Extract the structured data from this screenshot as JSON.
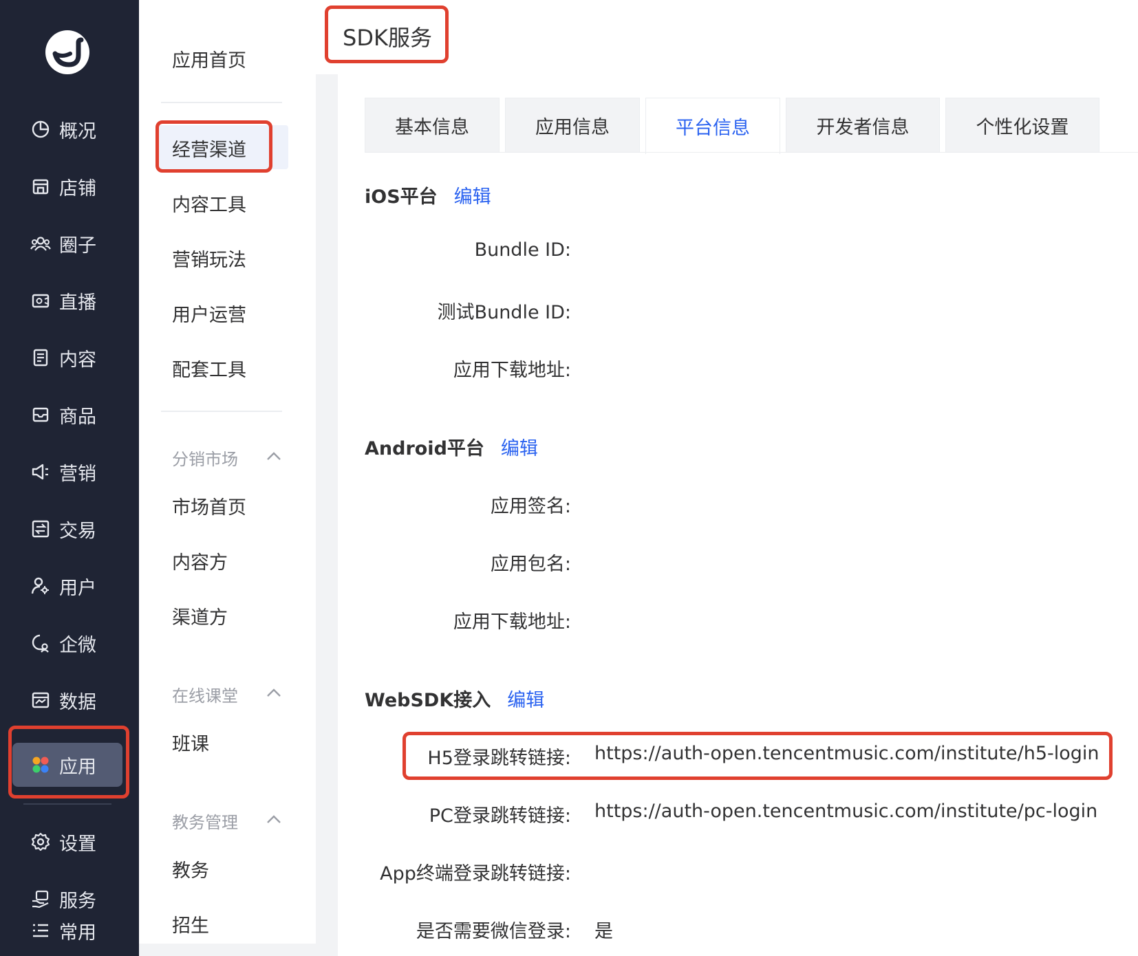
{
  "rail": {
    "items": [
      {
        "label": "概况",
        "icon": "pie-chart-icon"
      },
      {
        "label": "店铺",
        "icon": "store-icon"
      },
      {
        "label": "圈子",
        "icon": "group-icon"
      },
      {
        "label": "直播",
        "icon": "live-camera-icon"
      },
      {
        "label": "内容",
        "icon": "document-icon"
      },
      {
        "label": "商品",
        "icon": "inbox-icon"
      },
      {
        "label": "营销",
        "icon": "megaphone-icon"
      },
      {
        "label": "交易",
        "icon": "exchange-icon"
      },
      {
        "label": "用户",
        "icon": "user-settings-icon"
      },
      {
        "label": "企微",
        "icon": "wecom-icon"
      },
      {
        "label": "数据",
        "icon": "data-panel-icon"
      },
      {
        "label": "应用",
        "icon": "apps-icon",
        "active": true
      },
      {
        "label": "设置",
        "icon": "gear-icon"
      },
      {
        "label": "服务",
        "icon": "service-hand-icon"
      },
      {
        "label": "常用",
        "icon": "list-icon"
      }
    ]
  },
  "submenu": {
    "home": "应用首页",
    "items": [
      "经营渠道",
      "内容工具",
      "营销玩法",
      "用户运营",
      "配套工具"
    ],
    "groups": [
      {
        "title": "分销市场",
        "items": [
          "市场首页",
          "内容方",
          "渠道方"
        ]
      },
      {
        "title": "在线课堂",
        "items": [
          "班课"
        ]
      },
      {
        "title": "教务管理",
        "items": [
          "教务",
          "招生"
        ]
      }
    ]
  },
  "page": {
    "title": "SDK服务"
  },
  "tabs": [
    "基本信息",
    "应用信息",
    "平台信息",
    "开发者信息",
    "个性化设置"
  ],
  "active_tab": "平台信息",
  "sections": {
    "ios": {
      "title": "iOS平台",
      "edit": "编辑",
      "fields": [
        {
          "label": "Bundle ID:",
          "value": ""
        },
        {
          "label": "测试Bundle ID:",
          "value": ""
        },
        {
          "label": "应用下载地址:",
          "value": ""
        }
      ]
    },
    "android": {
      "title": "Android平台",
      "edit": "编辑",
      "fields": [
        {
          "label": "应用签名:",
          "value": ""
        },
        {
          "label": "应用包名:",
          "value": ""
        },
        {
          "label": "应用下载地址:",
          "value": ""
        }
      ]
    },
    "websdk": {
      "title": "WebSDK接入",
      "edit": "编辑",
      "fields": [
        {
          "label": "H5登录跳转链接:",
          "value": "https://auth-open.tencentmusic.com/institute/h5-login"
        },
        {
          "label": "PC登录跳转链接:",
          "value": "https://auth-open.tencentmusic.com/institute/pc-login"
        },
        {
          "label": "App终端登录跳转链接:",
          "value": ""
        },
        {
          "label": "是否需要微信登录:",
          "value": "是"
        }
      ]
    }
  },
  "colors": {
    "accent": "#2a62f0",
    "highlight": "#e0402f",
    "rail_bg": "#1f2434",
    "rail_active": "#535b73"
  }
}
